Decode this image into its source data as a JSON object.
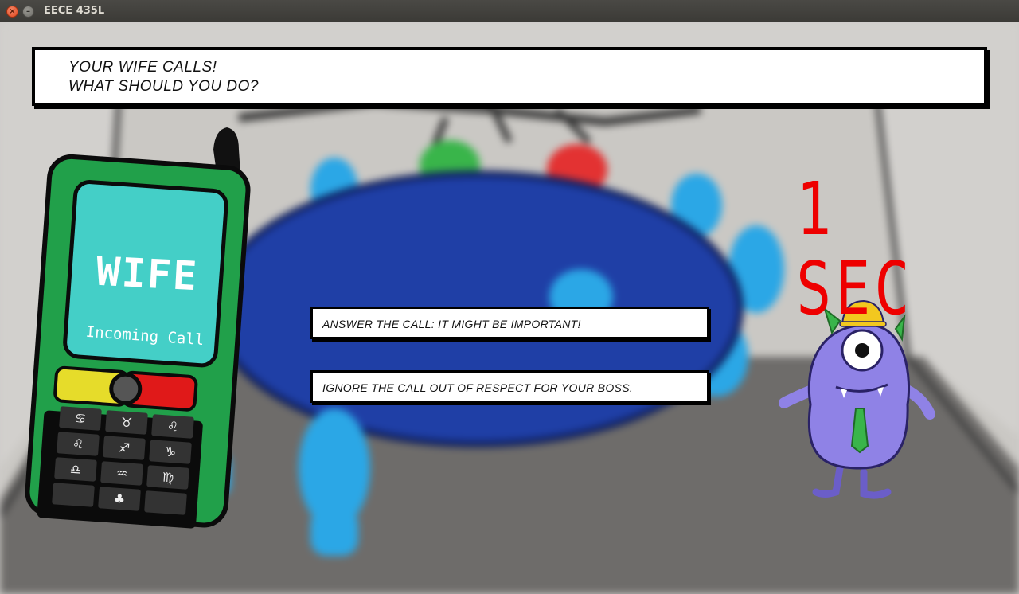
{
  "window": {
    "title": "EECE 435L",
    "close_glyph": "×",
    "minimize_glyph": "–"
  },
  "question": {
    "line1": "YOUR WIFE CALLS!",
    "line2": "WHAT SHOULD YOU DO?"
  },
  "answers": [
    {
      "label": "ANSWER THE CALL: IT MIGHT BE IMPORTANT!"
    },
    {
      "label": "IGNORE THE CALL OUT OF RESPECT FOR YOUR BOSS."
    }
  ],
  "timer": {
    "text": "1 SEC",
    "color": "#ee0000"
  },
  "phone": {
    "caller": "WIFE",
    "status": "Incoming Call",
    "body_color": "#21a04a",
    "screen_color": "#44cfc7",
    "keys": [
      "♋",
      "♉",
      "♌",
      "♌",
      "♐",
      "♑",
      "♎",
      "♒",
      "♍",
      "",
      "♣",
      ""
    ]
  },
  "colors": {
    "room_wall": "#cfcdca",
    "table": "#1f3fa6",
    "chairs": "#2ba7e6",
    "monster": "#8f82e6"
  }
}
